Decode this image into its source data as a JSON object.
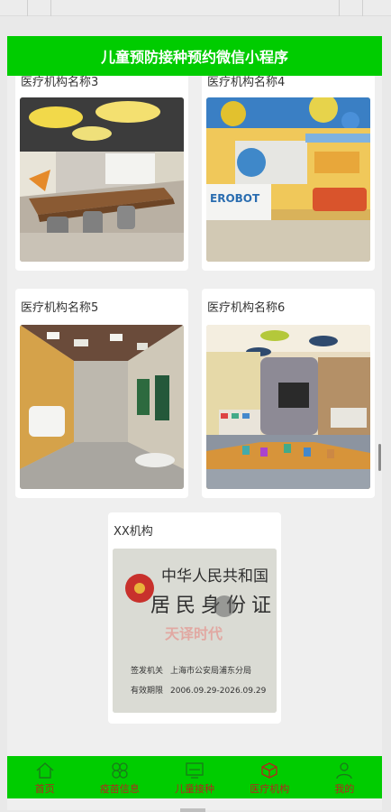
{
  "header": {
    "title": "儿童预防接种预约微信小程序"
  },
  "institutions": [
    {
      "name": "医疗机构名称3",
      "image": "classroom-photo"
    },
    {
      "name": "医疗机构名称4",
      "image": "reception-lobby-photo"
    },
    {
      "name": "医疗机构名称5",
      "image": "hallway-photo"
    },
    {
      "name": "医疗机构名称6",
      "image": "playroom-photo"
    },
    {
      "name": "XX机构",
      "image": "id-card-photo",
      "id_card": {
        "title": "中华人民共和国",
        "subtitle": "居民身份证",
        "authority_label": "签发机关",
        "authority_value": "上海市公安局浦东分局",
        "validity_label": "有效期限",
        "validity_value": "2006.09.29-2026.09.29",
        "watermark": "天译时代"
      }
    }
  ],
  "tabs": [
    {
      "label": "首页",
      "icon": "home-icon"
    },
    {
      "label": "疫苗信息",
      "icon": "clover-icon"
    },
    {
      "label": "儿童接种",
      "icon": "monitor-icon"
    },
    {
      "label": "医疗机构",
      "icon": "cube-icon"
    },
    {
      "label": "我的",
      "icon": "person-icon"
    }
  ],
  "colors": {
    "accent": "#00cc00",
    "tab_label": "#b3261e",
    "background": "#efefef"
  }
}
